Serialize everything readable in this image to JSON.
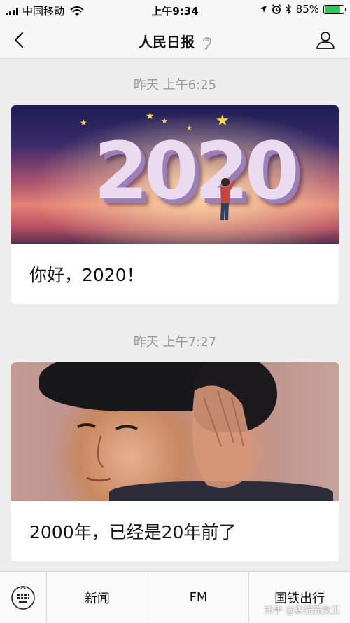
{
  "status_bar": {
    "carrier": "中国移动",
    "time": "上午9:34",
    "battery_percent": "85%",
    "battery_level": 0.85,
    "icons": [
      "signal-icon",
      "wifi-icon",
      "location-icon",
      "alarm-icon",
      "bluetooth-icon",
      "battery-icon"
    ]
  },
  "nav": {
    "title": "人民日报",
    "icons": [
      "back-icon",
      "ear-icon",
      "profile-icon"
    ]
  },
  "messages": [
    {
      "timestamp": "昨天 上午6:25",
      "cover_text": "2020",
      "title": "你好，2020！"
    },
    {
      "timestamp": "昨天 上午7:27",
      "title": "2000年，已经是20年前了"
    }
  ],
  "bottom_menu": {
    "items": [
      "新闻",
      "FM",
      "国铁出行"
    ]
  },
  "watermark": "知乎 @森猫猫女王",
  "colors": {
    "background": "#ededed",
    "battery": "#34c759",
    "timestamp": "#999999"
  }
}
